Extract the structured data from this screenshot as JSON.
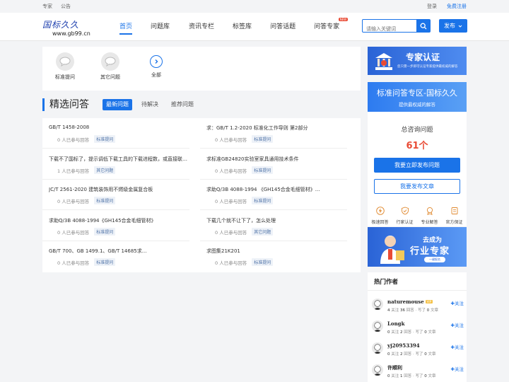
{
  "topbar": {
    "links": [
      "专家",
      "公告"
    ],
    "login": "登录",
    "register": "免费注册"
  },
  "header": {
    "logo_text": "国标久久",
    "logo_url": "www.gb99.cn",
    "nav": [
      "首页",
      "问题库",
      "资讯专栏",
      "标签库",
      "问答话题",
      "问答专家"
    ],
    "nav_new_badge": "NEW",
    "search_placeholder": "请输入关键词",
    "publish_label": "发布"
  },
  "ask_options": [
    {
      "label": "标准提问",
      "icon": "chat-bubble-icon"
    },
    {
      "label": "其它问题",
      "icon": "chat-bubble-icon"
    },
    {
      "label": "全部",
      "icon": "chevron-right-circle-icon"
    }
  ],
  "section": {
    "title": "精选问答",
    "tabs": [
      "最新问题",
      "待解决",
      "推荐问题"
    ]
  },
  "questions": [
    {
      "title": "GB/T 1458-2008",
      "participants": "0 人已参与回答",
      "tag": "标准提问"
    },
    {
      "title": "求：GB/T 1.2-2020 标准化工作导则 第2部分",
      "participants": "0 人已参与回答",
      "tag": "标准提问"
    },
    {
      "title": "下载不了国标了，提示调低下载工具的下载进程数，或直接联系...",
      "participants": "1 人已参与回答",
      "tag": "其它问题"
    },
    {
      "title": "求标准GB24820实验室家具通用技术条件",
      "participants": "0 人已参与回答",
      "tag": "标准提问"
    },
    {
      "title": "JC/T 2561-2020 建筑装饰用不燃级金属复合板",
      "participants": "0 人已参与回答",
      "tag": "标准提问"
    },
    {
      "title": "求助Q/3B 4088-1994 《GH145合金毛细管材》...",
      "participants": "0 人已参与回答",
      "tag": "标准提问"
    },
    {
      "title": "求助Q/3B 4088-1994《GH145合金毛细管材》",
      "participants": "0 人已参与回答",
      "tag": "标准提问"
    },
    {
      "title": "下载几个就不让下了，怎么处理",
      "participants": "0 人已参与回答",
      "tag": "其它问题"
    },
    {
      "title": "GB/T 700、GB 1499.1、GB/T 14685求...",
      "participants": "0 人已参与回答",
      "tag": "标准提问"
    },
    {
      "title": "求图集21K201",
      "participants": "0 人已参与回答",
      "tag": "标准提问"
    }
  ],
  "expert_banner": {
    "title": "专家认证",
    "subtitle": "您只需一步即可认证专家提供最权威的解答"
  },
  "zone": {
    "title": "标准问答专区-国标久久",
    "subtitle": "提供最权威的解答",
    "count_label": "总咨询问题",
    "count": "61个",
    "btn_ask": "我要立即发布问题",
    "btn_article": "我要发布文章"
  },
  "features": [
    {
      "label": "极速回答",
      "icon": "lightning-icon"
    },
    {
      "label": "行家认证",
      "icon": "shield-icon"
    },
    {
      "label": "专业解答",
      "icon": "medal-icon"
    },
    {
      "label": "官方保证",
      "icon": "guarantee-icon"
    }
  ],
  "industry_banner": {
    "line1": "去成为",
    "line2": "行业专家",
    "cta": "一键报名"
  },
  "authors_title": "热门作者",
  "authors": [
    {
      "name": "naturemouse",
      "vip": "VIP",
      "follows": "4",
      "answers": "36",
      "articles": "0",
      "follow_label": "✚关注"
    },
    {
      "name": "Longk",
      "vip": "",
      "follows": "0",
      "answers": "2",
      "articles": "0",
      "follow_label": "✚关注"
    },
    {
      "name": "yj20953394",
      "vip": "",
      "follows": "0",
      "answers": "2",
      "articles": "0",
      "follow_label": "✚关注"
    },
    {
      "name": "许顺利",
      "vip": "",
      "follows": "0",
      "answers": "1",
      "articles": "0",
      "follow_label": "✚关注"
    }
  ],
  "author_stat_labels": {
    "follow": "关注",
    "answer": "回答",
    "article": "文章",
    "sep": "· 写了"
  },
  "colors": {
    "primary": "#1a73e8",
    "accent_red": "#e94b35",
    "background": "#f3f4f6"
  }
}
